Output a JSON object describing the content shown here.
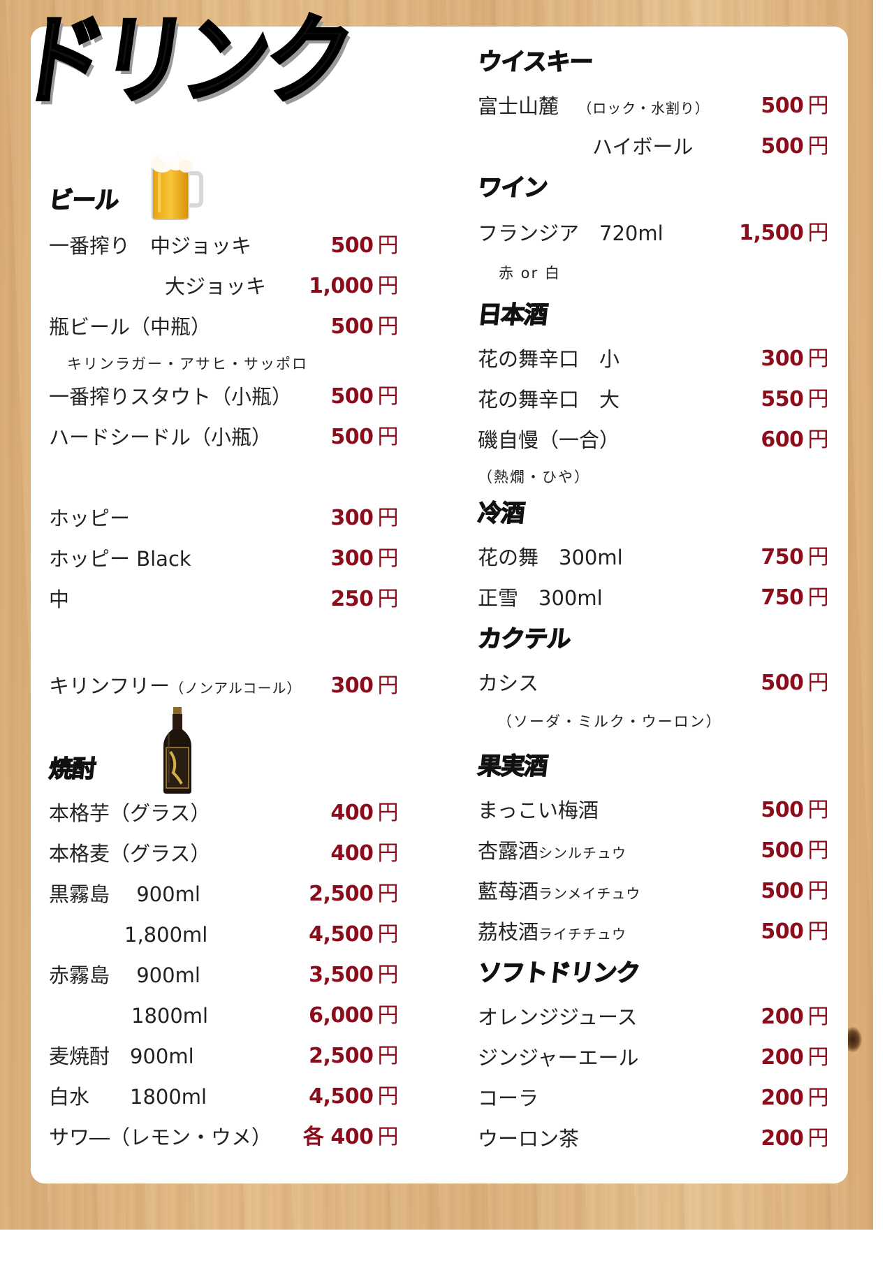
{
  "title": "ドリンク",
  "left": {
    "beer": {
      "category": "ビール",
      "items": [
        {
          "name": "一番搾り　中ジョッキ",
          "price": "500",
          "yen": "円"
        },
        {
          "name": "大ジョッキ",
          "price": "1,000",
          "yen": "円"
        },
        {
          "name": "瓶ビール（中瓶）",
          "price": "500",
          "yen": "円"
        }
      ],
      "note": "キリンラガー・アサヒ・サッポロ",
      "items2": [
        {
          "name": "一番搾りスタウト（小瓶）",
          "price": "500",
          "yen": "円"
        },
        {
          "name": "ハードシードル（小瓶）",
          "price": "500",
          "yen": "円"
        }
      ]
    },
    "hoppy": [
      {
        "name": "ホッピー",
        "price": "300",
        "yen": "円"
      },
      {
        "name": "ホッピー Black",
        "price": "300",
        "yen": "円"
      },
      {
        "name": "中",
        "price": "250",
        "yen": "円"
      }
    ],
    "kirin_free": {
      "name": "キリンフリー",
      "suffix": "（ノンアルコール）",
      "price": "300",
      "yen": "円"
    },
    "shochu": {
      "category": "焼酎",
      "items": [
        {
          "name": "本格芋（グラス）",
          "price": "400",
          "yen": "円"
        },
        {
          "name": "本格麦（グラス）",
          "price": "400",
          "yen": "円"
        },
        {
          "name": "黒霧島　 900ml",
          "price": "2,500",
          "yen": "円"
        },
        {
          "name": "1,800ml",
          "price": "4,500",
          "yen": "円"
        },
        {
          "name": "赤霧島　 900ml",
          "price": "3,500",
          "yen": "円"
        },
        {
          "name": "1800ml",
          "price": "6,000",
          "yen": "円"
        },
        {
          "name": "麦焼酎　900ml",
          "price": "2,500",
          "yen": "円"
        },
        {
          "name": "白水　　1800ml",
          "price": "4,500",
          "yen": "円"
        },
        {
          "name": "サワ―（レモン・ウメ）",
          "price": "各 400",
          "yen": "円"
        }
      ]
    }
  },
  "right": {
    "whisky": {
      "category": "ウイスキー",
      "items": [
        {
          "name": "富士山麓",
          "suffix": "（ロック・水割り）",
          "price": "500",
          "yen": "円"
        },
        {
          "name": "ハイボール",
          "price": "500",
          "yen": "円"
        }
      ]
    },
    "wine": {
      "category": "ワイン",
      "items": [
        {
          "name": "フランジア　720ml",
          "price": "1,500",
          "yen": "円"
        }
      ],
      "note": "赤 or 白"
    },
    "sake": {
      "category": "日本酒",
      "items": [
        {
          "name": "花の舞辛口　小",
          "price": "300",
          "yen": "円"
        },
        {
          "name": "花の舞辛口　大",
          "price": "550",
          "yen": "円"
        },
        {
          "name": "磯自慢（一合）",
          "price": "600",
          "yen": "円"
        }
      ],
      "note": "（熱燗・ひや）"
    },
    "cold_sake": {
      "category": "冷酒",
      "items": [
        {
          "name": "花の舞　300ml",
          "price": "750",
          "yen": "円"
        },
        {
          "name": "正雪　300ml",
          "price": "750",
          "yen": "円"
        }
      ]
    },
    "cocktail": {
      "category": "カクテル",
      "items": [
        {
          "name": "カシス",
          "price": "500",
          "yen": "円"
        }
      ],
      "note": "（ソーダ・ミルク・ウーロン）"
    },
    "fruit_wine": {
      "category": "果実酒",
      "items": [
        {
          "name": "まっこい梅酒",
          "suffix": "",
          "price": "500",
          "yen": "円"
        },
        {
          "name": "杏露酒",
          "suffix": "シンルチュウ",
          "price": "500",
          "yen": "円"
        },
        {
          "name": "藍苺酒",
          "suffix": "ランメイチュウ",
          "price": "500",
          "yen": "円"
        },
        {
          "name": "茘枝酒",
          "suffix": "ライチチュウ",
          "price": "500",
          "yen": "円"
        }
      ]
    },
    "soft": {
      "category": "ソフトドリンク",
      "items": [
        {
          "name": "オレンジジュース",
          "price": "200",
          "yen": "円"
        },
        {
          "name": "ジンジャーエール",
          "price": "200",
          "yen": "円"
        },
        {
          "name": "コーラ",
          "price": "200",
          "yen": "円"
        },
        {
          "name": "ウーロン茶",
          "price": "200",
          "yen": "円"
        }
      ]
    }
  }
}
